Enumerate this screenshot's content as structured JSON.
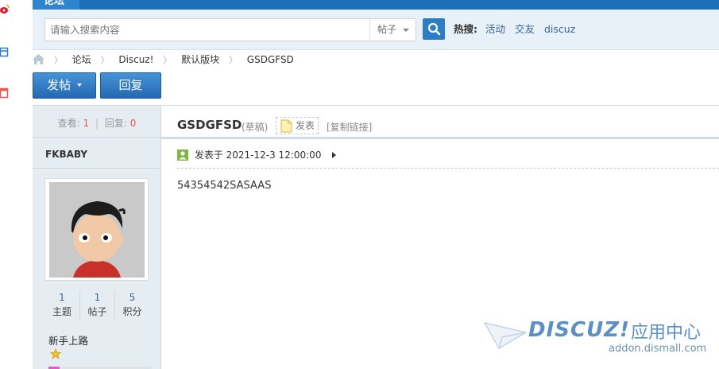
{
  "nav": {
    "forum_tab": "论坛"
  },
  "search": {
    "placeholder": "请输入搜索内容",
    "type": "帖子",
    "hot_label": "热搜:",
    "hot_links": [
      "活动",
      "交友",
      "discuz"
    ]
  },
  "breadcrumb": [
    "论坛",
    "Discuz!",
    "默认版块",
    "GSDGFSD"
  ],
  "actions": {
    "post": "发帖",
    "reply": "回复"
  },
  "thread_stats": {
    "views_label": "查看:",
    "views": "1",
    "replies_label": "回复:",
    "replies": "0"
  },
  "author": {
    "name": "FKBABY",
    "stats": [
      {
        "value": "1",
        "label": "主题"
      },
      {
        "value": "1",
        "label": "帖子"
      },
      {
        "value": "5",
        "label": "积分"
      }
    ],
    "rank": "新手上路",
    "rank_stars": 1
  },
  "post": {
    "title": "GSDGFSD",
    "draft_tag": "(草稿)",
    "publish_label": "发表",
    "copy_link": "[复制链接]",
    "posted_at": "发表于 2021-12-3 12:00:00",
    "content": "54354542SASAAS"
  },
  "watermark": {
    "brand": "DISCUZ!",
    "center": "应用中心",
    "url": "addon.dismall.com"
  },
  "colors": {
    "nav_blue": "#1d6fb8",
    "button_blue": "#2b7dc5",
    "sidebar_bg": "#e5edf2",
    "accent_red": "#e55555",
    "online_green": "#7bb93f"
  }
}
